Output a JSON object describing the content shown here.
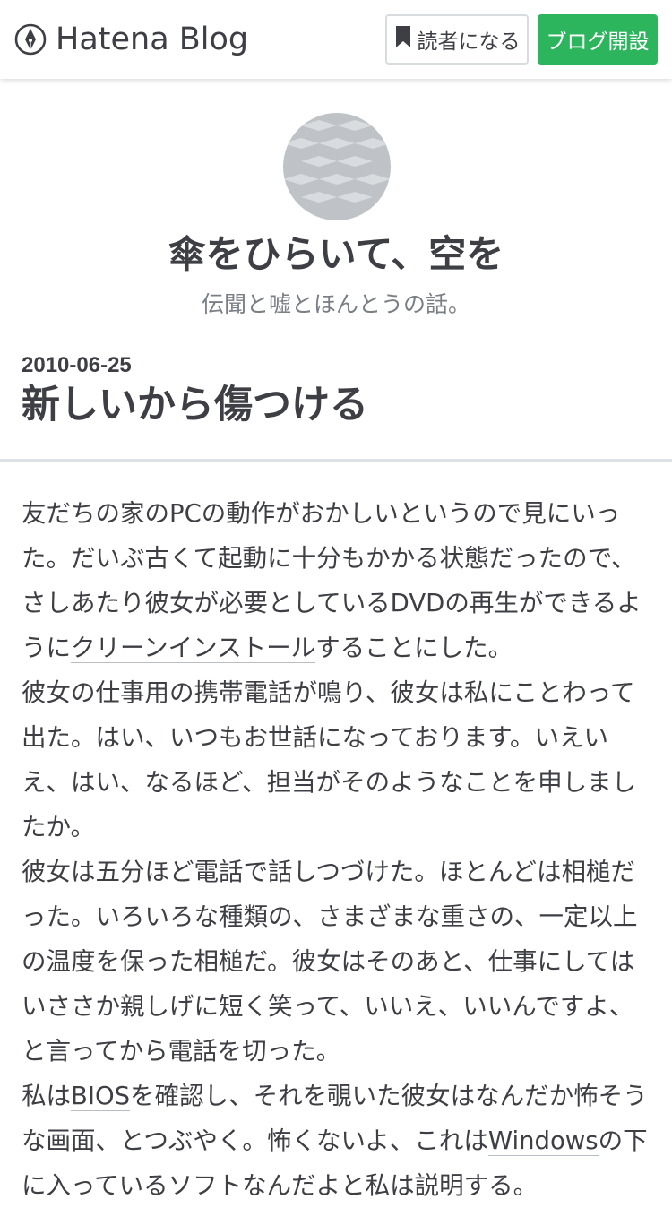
{
  "header": {
    "logo_text": "Hatena Blog",
    "subscribe_label": "読者になる",
    "create_blog_label": "ブログ開設"
  },
  "blog": {
    "title": "傘をひらいて、空を",
    "description": "伝聞と嘘とほんとうの話。"
  },
  "entry": {
    "date": "2010-06-25",
    "title": "新しいから傷つける",
    "paragraphs": [
      {
        "before": "友だちの家のPCの動作がおかしいというので見にいった。だいぶ古くて起動に十分もかかる状態だったので、さしあたり彼女が必要としているDVDの再生ができるように",
        "link": "クリーンインストール",
        "after": "することにした。"
      },
      {
        "text": "彼女の仕事用の携帯電話が鳴り、彼女は私にことわって出た。はい、いつもお世話になっております。いえいえ、はい、なるほど、担当がそのようなことを申しましたか。"
      },
      {
        "text": "彼女は五分ほど電話で話しつづけた。ほとんどは相槌だった。いろいろな種類の、さまざまな重さの、一定以上の温度を保った相槌だ。彼女はそのあと、仕事にしてはいささか親しげに短く笑って、いいえ、いいんですよ、と言ってから電話を切った。"
      },
      {
        "before": "私は",
        "link": "BIOS",
        "middle": "を確認し、それを覗いた彼女はなんだか怖そうな画面、とつぶやく。怖くないよ、これは",
        "link2": "Windows",
        "after": "の下に入っているソフトなんだよと私は説明する。"
      }
    ]
  },
  "colors": {
    "text": "#3d3f44",
    "muted": "#7a7e85",
    "accent_green": "#2db55d",
    "divider": "#dde2e8"
  },
  "icons": {
    "logo": "hatena-pen-nib-icon",
    "subscribe": "bookmark-icon"
  }
}
